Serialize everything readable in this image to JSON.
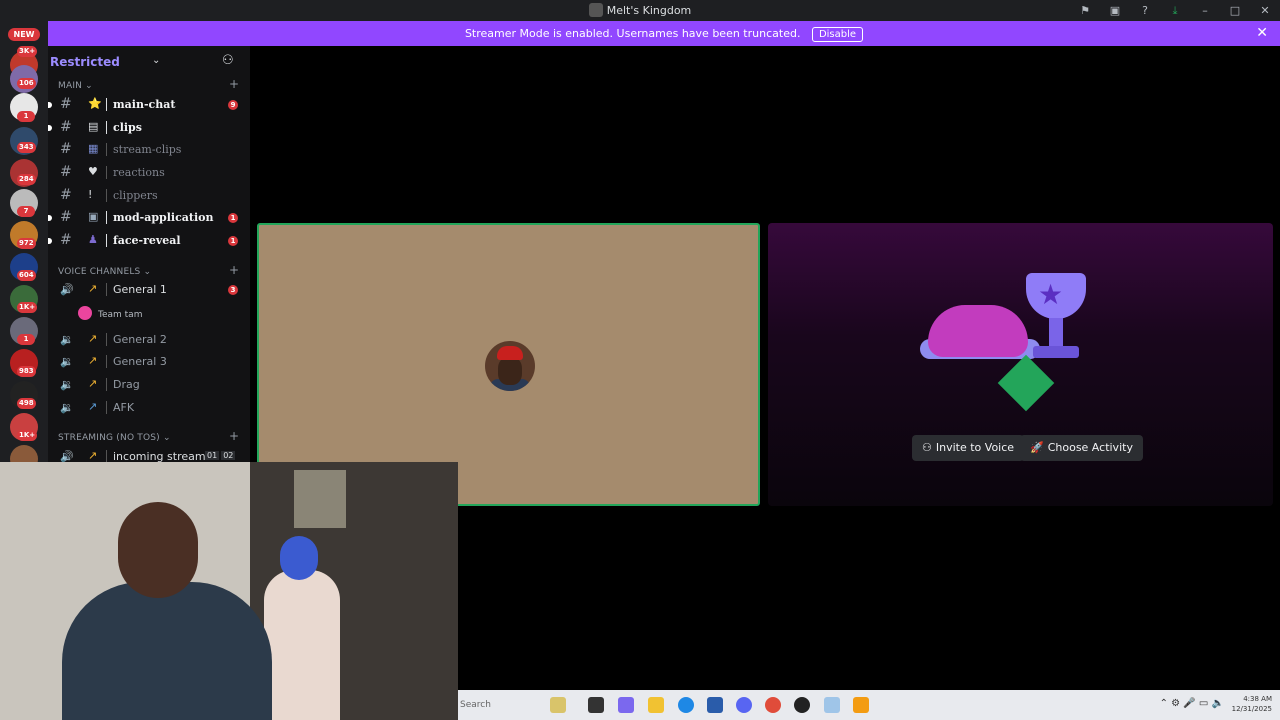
{
  "window": {
    "title": "Melt's Kingdom"
  },
  "titlebar_icons": [
    "pin-icon",
    "inbox-icon",
    "help-icon",
    "download-icon",
    "minimize-icon",
    "maximize-icon",
    "close-icon"
  ],
  "banner": {
    "message": "Streamer Mode is enabled. Usernames have been truncated.",
    "disable_label": "Disable",
    "color": "#9147ff"
  },
  "server_list": {
    "new_label": "NEW",
    "badges": [
      "3K+",
      "106",
      "1",
      "343",
      "284",
      "7",
      "972",
      "604",
      "1K+",
      "1",
      "983",
      "498",
      "1K+"
    ]
  },
  "server_header": {
    "name": "Restricted"
  },
  "categories": {
    "main": "MAIN",
    "voice": "VOICE CHANNELS",
    "streaming": "STREAMING (NO TOS)"
  },
  "text_channels": [
    {
      "name": "main-chat",
      "unread": true,
      "mention": "9"
    },
    {
      "name": "clips",
      "unread": true,
      "mention": ""
    },
    {
      "name": "stream-clips",
      "unread": false,
      "mention": ""
    },
    {
      "name": "reactions",
      "unread": false,
      "mention": ""
    },
    {
      "name": "clippers",
      "unread": false,
      "mention": ""
    },
    {
      "name": "mod-application",
      "unread": true,
      "mention": "1"
    },
    {
      "name": "face-reveal",
      "unread": true,
      "mention": "1"
    }
  ],
  "voice_channels": [
    {
      "name": "General 1",
      "live": true,
      "mention": "3"
    },
    {
      "name": "General 2",
      "live": false
    },
    {
      "name": "General 3",
      "live": false
    },
    {
      "name": "Drag",
      "live": false
    },
    {
      "name": "AFK",
      "live": false
    }
  ],
  "voice_user": {
    "name": "Team tam"
  },
  "streaming_channel": {
    "name": "incoming stream",
    "count_a": "01",
    "count_b": "02"
  },
  "activity": {
    "invite_label": "Invite to Voice",
    "choose_label": "Choose Activity"
  },
  "taskbar": {
    "search_placeholder": "Search",
    "time": "4:38 AM",
    "date": "12/31/2025"
  }
}
